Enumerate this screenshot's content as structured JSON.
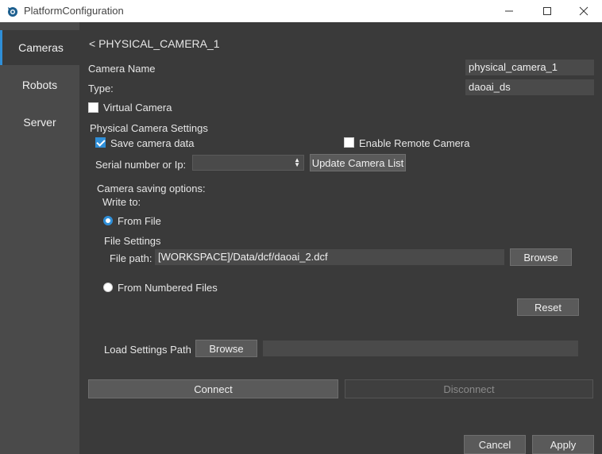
{
  "window": {
    "title": "PlatformConfiguration"
  },
  "sidebar": {
    "items": [
      {
        "label": "Cameras"
      },
      {
        "label": "Robots"
      },
      {
        "label": "Server"
      }
    ]
  },
  "header": {
    "back_label": "< PHYSICAL_CAMERA_1"
  },
  "form": {
    "camera_name_label": "Camera Name",
    "camera_name_value": "physical_camera_1",
    "type_label": "Type:",
    "type_value": "daoai_ds",
    "virtual_camera_label": "Virtual Camera",
    "physical_settings_label": "Physical Camera Settings",
    "save_camera_data_label": "Save camera data",
    "enable_remote_label": "Enable Remote Camera",
    "serial_label": "Serial number or Ip:",
    "serial_value": "",
    "update_list_label": "Update Camera List",
    "saving_options_label": "Camera saving options:",
    "write_to_label": "Write to:",
    "from_file_label": "From File",
    "file_settings_label": "File Settings",
    "file_path_label": "File path:",
    "file_path_value": "[WORKSPACE]/Data/dcf/daoai_2.dcf",
    "browse_label": "Browse",
    "from_numbered_label": "From Numbered Files",
    "reset_label": "Reset",
    "load_settings_label": "Load Settings Path",
    "load_browse_label": "Browse",
    "load_settings_value": ""
  },
  "actions": {
    "connect_label": "Connect",
    "disconnect_label": "Disconnect"
  },
  "footer": {
    "cancel_label": "Cancel",
    "apply_label": "Apply"
  },
  "colors": {
    "accent": "#2f8fd8",
    "background": "#3a3a3a",
    "sidebar": "#4a4a4a"
  }
}
